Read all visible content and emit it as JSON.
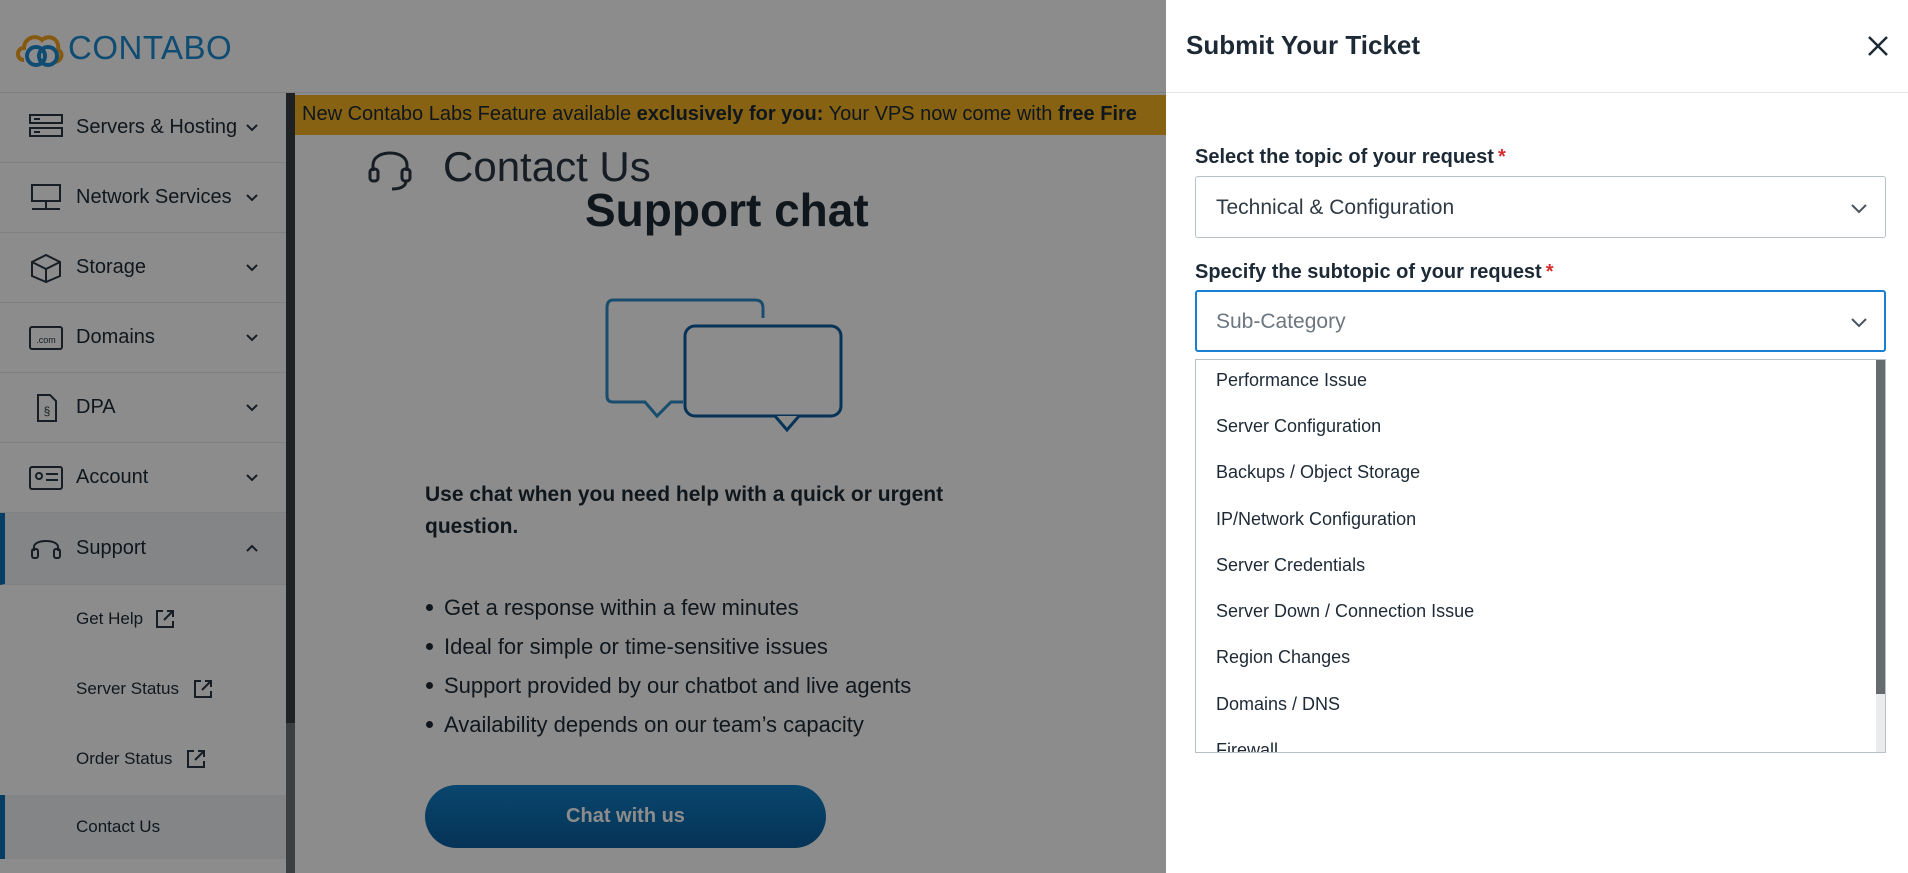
{
  "logo": {
    "text": "CONTABO"
  },
  "sidebar": {
    "items": [
      {
        "label": "Servers & Hosting",
        "icon": "servers-icon"
      },
      {
        "label": "Network Services",
        "icon": "network-icon"
      },
      {
        "label": "Storage",
        "icon": "storage-box-icon"
      },
      {
        "label": "Domains",
        "icon": "domain-icon"
      },
      {
        "label": "DPA",
        "icon": "document-icon"
      },
      {
        "label": "Account",
        "icon": "id-card-icon"
      },
      {
        "label": "Support",
        "icon": "headset-icon",
        "expanded": true
      }
    ],
    "sub_items": [
      {
        "label": "Get Help",
        "icon": "external-link-icon"
      },
      {
        "label": "Server Status",
        "icon": "external-link-icon"
      },
      {
        "label": "Order Status",
        "icon": "external-link-icon"
      },
      {
        "label": "Contact Us",
        "active": true
      }
    ]
  },
  "main": {
    "banner": {
      "part1": "New Contabo Labs Feature available ",
      "part2_bold": "exclusively for you:",
      "part3": " Your VPS now come with ",
      "part4_bold": "free Fire"
    },
    "contact_heading": "Contact Us",
    "support_title": "Support chat",
    "chat_description": "Use chat when you need help with a quick or urgent question.",
    "bullets": [
      "Get a response within a few minutes",
      "Ideal for simple or time-sensitive issues",
      "Support provided by our chatbot and live agents",
      "Availability depends on our team’s capacity"
    ],
    "chat_button": "Chat with us"
  },
  "drawer": {
    "title": "Submit Your Ticket",
    "topic_label": "Select the topic of your request",
    "topic_value": "Technical & Configuration",
    "subtopic_label": "Specify the subtopic of your request",
    "subtopic_placeholder": "Sub-Category",
    "required_mark": "*",
    "options": [
      "Performance Issue",
      "Server Configuration",
      "Backups / Object Storage",
      "IP/Network Configuration",
      "Server Credentials",
      "Server Down / Connection Issue",
      "Region Changes",
      "Domains / DNS",
      "Firewall"
    ]
  },
  "colors": {
    "accent": "#0a6fb7",
    "banner": "#f4b222",
    "required": "#d92d2d",
    "focus": "#1b7fd1"
  }
}
